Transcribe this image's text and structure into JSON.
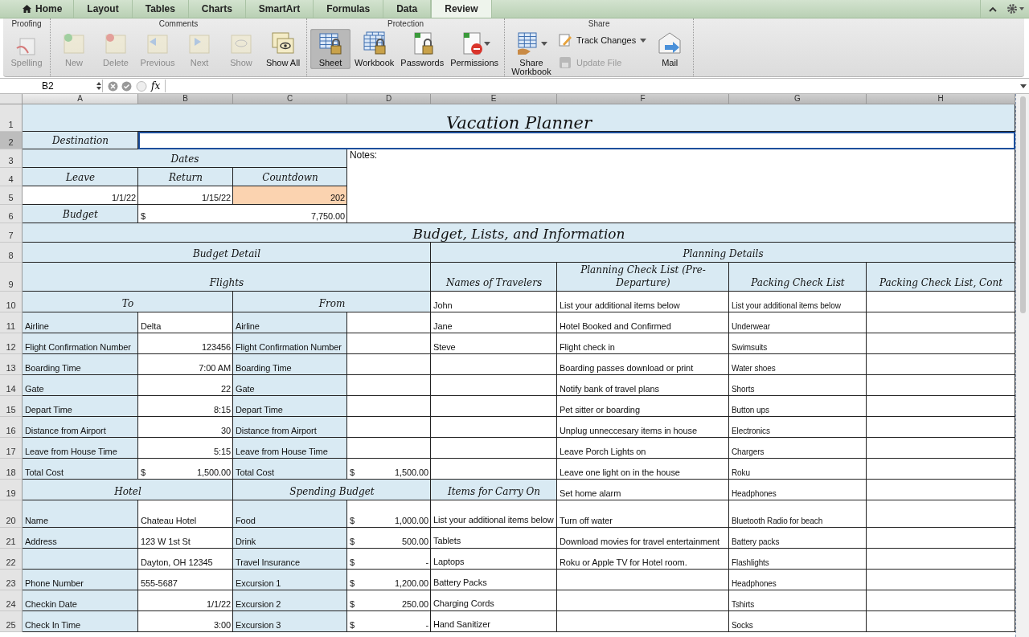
{
  "ribbon_tabs": [
    {
      "label": "Home",
      "selected": false
    },
    {
      "label": "Layout",
      "selected": false
    },
    {
      "label": "Tables",
      "selected": false
    },
    {
      "label": "Charts",
      "selected": false
    },
    {
      "label": "SmartArt",
      "selected": false
    },
    {
      "label": "Formulas",
      "selected": false
    },
    {
      "label": "Data",
      "selected": false
    },
    {
      "label": "Review",
      "selected": true
    }
  ],
  "ribbon_groups": [
    {
      "title": "Proofing",
      "buttons": [
        {
          "kind": "large",
          "label": "Spelling",
          "disabled": true,
          "selected": false,
          "dropdown": false
        }
      ]
    },
    {
      "title": "Comments",
      "buttons": [
        {
          "kind": "large",
          "label": "New",
          "disabled": true,
          "selected": false,
          "dropdown": false
        },
        {
          "kind": "large",
          "label": "Delete",
          "disabled": true,
          "selected": false,
          "dropdown": false
        },
        {
          "kind": "large",
          "label": "Previous",
          "disabled": true,
          "selected": false,
          "dropdown": false
        },
        {
          "kind": "large",
          "label": "Next",
          "disabled": true,
          "selected": false,
          "dropdown": false
        },
        {
          "kind": "large",
          "label": "Show",
          "disabled": true,
          "selected": false,
          "dropdown": false
        },
        {
          "kind": "large",
          "label": "Show All",
          "disabled": false,
          "selected": false,
          "dropdown": false
        }
      ]
    },
    {
      "title": "Protection",
      "buttons": [
        {
          "kind": "large",
          "label": "Sheet",
          "disabled": false,
          "selected": true,
          "dropdown": false
        },
        {
          "kind": "large",
          "label": "Workbook",
          "disabled": false,
          "selected": false,
          "dropdown": false
        },
        {
          "kind": "large",
          "label": "Passwords",
          "disabled": false,
          "selected": false,
          "dropdown": false
        },
        {
          "kind": "large",
          "label": "Permissions",
          "disabled": false,
          "selected": false,
          "dropdown": true
        }
      ]
    },
    {
      "title": "Share",
      "buttons": [
        {
          "kind": "large",
          "label": "Share Workbook",
          "disabled": false,
          "selected": false,
          "dropdown": true
        },
        {
          "kind": "small",
          "label": "Track Changes",
          "disabled": false,
          "selected": false,
          "dropdown": true
        },
        {
          "kind": "small",
          "label": "Update File",
          "disabled": true,
          "selected": false,
          "dropdown": false
        },
        {
          "kind": "large",
          "label": "Mail",
          "disabled": false,
          "selected": false,
          "dropdown": false
        }
      ]
    }
  ],
  "formula_bar": {
    "name_box": "B2",
    "function_label": "fx"
  },
  "sheet": {
    "columns": [
      {
        "label": "A",
        "selected": false
      },
      {
        "label": "B",
        "selected": true
      },
      {
        "label": "C",
        "selected": true
      },
      {
        "label": "D",
        "selected": true
      },
      {
        "label": "E",
        "selected": true
      },
      {
        "label": "F",
        "selected": true
      },
      {
        "label": "G",
        "selected": true
      },
      {
        "label": "H",
        "selected": true
      }
    ],
    "row_numbers": [
      {
        "label": "1",
        "selected": false
      },
      {
        "label": "2",
        "selected": true
      },
      {
        "label": "3",
        "selected": false
      },
      {
        "label": "4",
        "selected": false
      },
      {
        "label": "5",
        "selected": false
      },
      {
        "label": "6",
        "selected": false
      },
      {
        "label": "7",
        "selected": false
      },
      {
        "label": "8",
        "selected": false
      },
      {
        "label": "9",
        "selected": false
      },
      {
        "label": "10",
        "selected": false
      },
      {
        "label": "11",
        "selected": false
      },
      {
        "label": "12",
        "selected": false
      },
      {
        "label": "13",
        "selected": false
      },
      {
        "label": "14",
        "selected": false
      },
      {
        "label": "15",
        "selected": false
      },
      {
        "label": "16",
        "selected": false
      },
      {
        "label": "17",
        "selected": false
      },
      {
        "label": "18",
        "selected": false
      },
      {
        "label": "19",
        "selected": false
      },
      {
        "label": "20",
        "selected": false
      },
      {
        "label": "21",
        "selected": false
      },
      {
        "label": "22",
        "selected": false
      },
      {
        "label": "23",
        "selected": false
      },
      {
        "label": "24",
        "selected": false
      },
      {
        "label": "25",
        "selected": false
      }
    ],
    "title": "Vacation Planner",
    "destination": {
      "label": "Destination",
      "selected": true
    },
    "dates": {
      "heading": "Dates",
      "columns": [
        {
          "label": "Leave",
          "value": "1/1/22",
          "highlighted": false
        },
        {
          "label": "Return",
          "value": "1/15/22",
          "highlighted": false
        },
        {
          "label": "Countdown",
          "value": "202",
          "highlighted": true
        }
      ]
    },
    "budget": {
      "label": "Budget",
      "symbol": "$",
      "value": "7,750.00"
    },
    "notes_label": "Notes:",
    "section_title": "Budget, Lists, and Information",
    "budget_detail": {
      "heading": "Budget Detail",
      "flights_heading": "Flights",
      "legs": [
        {
          "heading": "To",
          "rows": [
            {
              "label": "Airline",
              "kind": "text",
              "value": "Delta"
            },
            {
              "label": "Flight Confirmation Number",
              "kind": "number",
              "value": "123456"
            },
            {
              "label": "Boarding Time",
              "kind": "number",
              "value": "7:00 AM"
            },
            {
              "label": "Gate",
              "kind": "number",
              "value": "22"
            },
            {
              "label": "Depart Time",
              "kind": "number",
              "value": "8:15"
            },
            {
              "label": "Distance from Airport",
              "kind": "number",
              "value": "30"
            },
            {
              "label": "Leave from House Time",
              "kind": "number",
              "value": "5:15"
            },
            {
              "label": "Total Cost",
              "kind": "currency",
              "symbol": "$",
              "value": "1,500.00"
            }
          ]
        },
        {
          "heading": "From",
          "rows": [
            {
              "label": "Airline"
            },
            {
              "label": "Flight Confirmation Number"
            },
            {
              "label": "Boarding Time"
            },
            {
              "label": "Gate"
            },
            {
              "label": "Depart Time"
            },
            {
              "label": "Distance from Airport"
            },
            {
              "label": "Leave from House Time"
            },
            {
              "label": "Total Cost",
              "kind": "currency",
              "symbol": "$",
              "value": "1,500.00"
            }
          ]
        }
      ],
      "lower": [
        {
          "heading": "Hotel",
          "rows": [
            {
              "label": "Name",
              "kind": "text",
              "value": "Chateau Hotel"
            },
            {
              "label": "Address",
              "kind": "text",
              "value": "123 W 1st St"
            },
            {
              "kind": "text",
              "value": "Dayton, OH 12345"
            },
            {
              "label": "Phone Number",
              "kind": "text",
              "value": "555-5687"
            },
            {
              "label": "Checkin Date",
              "kind": "number",
              "value": "1/1/22"
            },
            {
              "label": "Check In Time",
              "kind": "number",
              "value": "3:00"
            }
          ]
        },
        {
          "heading": "Spending Budget",
          "rows": [
            {
              "label": "Food",
              "kind": "currency",
              "symbol": "$",
              "value": "1,000.00"
            },
            {
              "label": "Drink",
              "kind": "currency",
              "symbol": "$",
              "value": "500.00"
            },
            {
              "label": "Travel Insurance",
              "kind": "currency",
              "symbol": "$",
              "value": "-"
            },
            {
              "label": "Excursion 1",
              "kind": "currency",
              "symbol": "$",
              "value": "1,200.00"
            },
            {
              "label": "Excursion 2",
              "kind": "currency",
              "symbol": "$",
              "value": "250.00"
            },
            {
              "label": "Excursion 3",
              "kind": "currency",
              "symbol": "$",
              "value": "-"
            }
          ]
        }
      ]
    },
    "planning_details": {
      "heading": "Planning Details",
      "lists": [
        {
          "heading": "Names of Travelers",
          "items": [
            "John",
            "Jane",
            "Steve"
          ]
        },
        {
          "heading": "Planning Check List (Pre-Departure)",
          "items": [
            "List your additional items below",
            "Hotel Booked and Confirmed",
            "Flight check in",
            "Boarding passes download or print",
            "Notify bank of travel plans",
            "Pet sitter or boarding",
            "Unplug unneccesary items in house",
            "Leave Porch Lights on",
            "Leave one light on in the house",
            "Set home alarm",
            "Turn off water",
            "Download movies for travel entertainment",
            "Roku or Apple TV for Hotel room."
          ]
        },
        {
          "heading": "Packing Check List",
          "items": [
            "List your additional items below",
            "Underwear",
            "Swimsuits",
            "Water shoes",
            "Shorts",
            "Button ups",
            "Electronics",
            "Chargers",
            "Roku",
            "Headphones",
            "Bluetooth Radio for beach",
            "Battery packs",
            "Flashlights",
            "Headphones",
            "Tshirts",
            "Socks"
          ]
        },
        {
          "heading": "Packing Check List, Cont"
        }
      ],
      "carry_on": {
        "heading": "Items for Carry On",
        "items": [
          "List your additional items below",
          "Tablets",
          "Laptops",
          "Battery Packs",
          "Charging Cords",
          "Hand Sanitizer"
        ]
      }
    }
  }
}
